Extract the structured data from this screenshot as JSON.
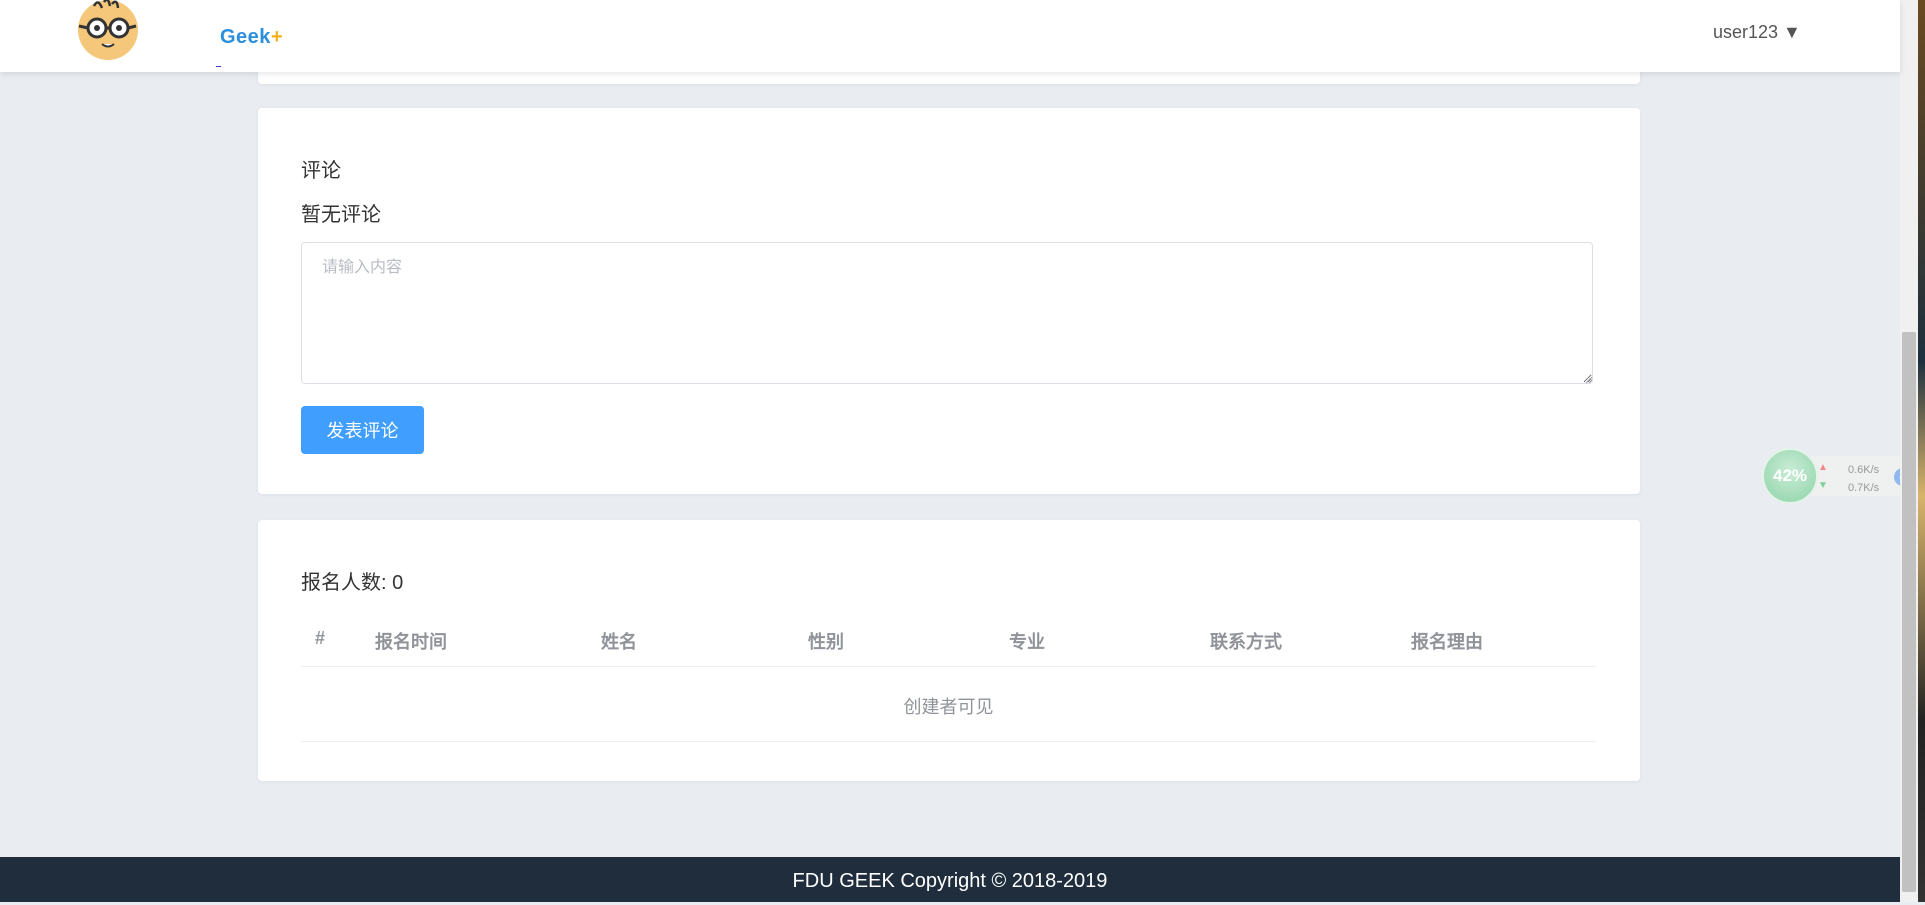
{
  "header": {
    "brand_name": "Geek",
    "brand_plus": "+",
    "user_menu": "user123 ▼"
  },
  "comments": {
    "title": "评论",
    "empty_text": "暂无评论",
    "input_placeholder": "请输入内容",
    "input_value": "",
    "submit_label": "发表评论"
  },
  "signups": {
    "count_text": "报名人数: 0",
    "columns": [
      "#",
      "报名时间",
      "姓名",
      "性别",
      "专业",
      "联系方式",
      "报名理由"
    ],
    "empty_text": "创建者可见"
  },
  "footer": {
    "copyright": "FDU GEEK Copyright © 2018-2019"
  },
  "network_widget": {
    "percent": "42%",
    "upload_speed": "0.6K/s",
    "download_speed": "0.7K/s"
  },
  "colors": {
    "primary": "#409eff",
    "footer_bg": "#1f2d3d",
    "page_bg": "#e9edf2"
  }
}
